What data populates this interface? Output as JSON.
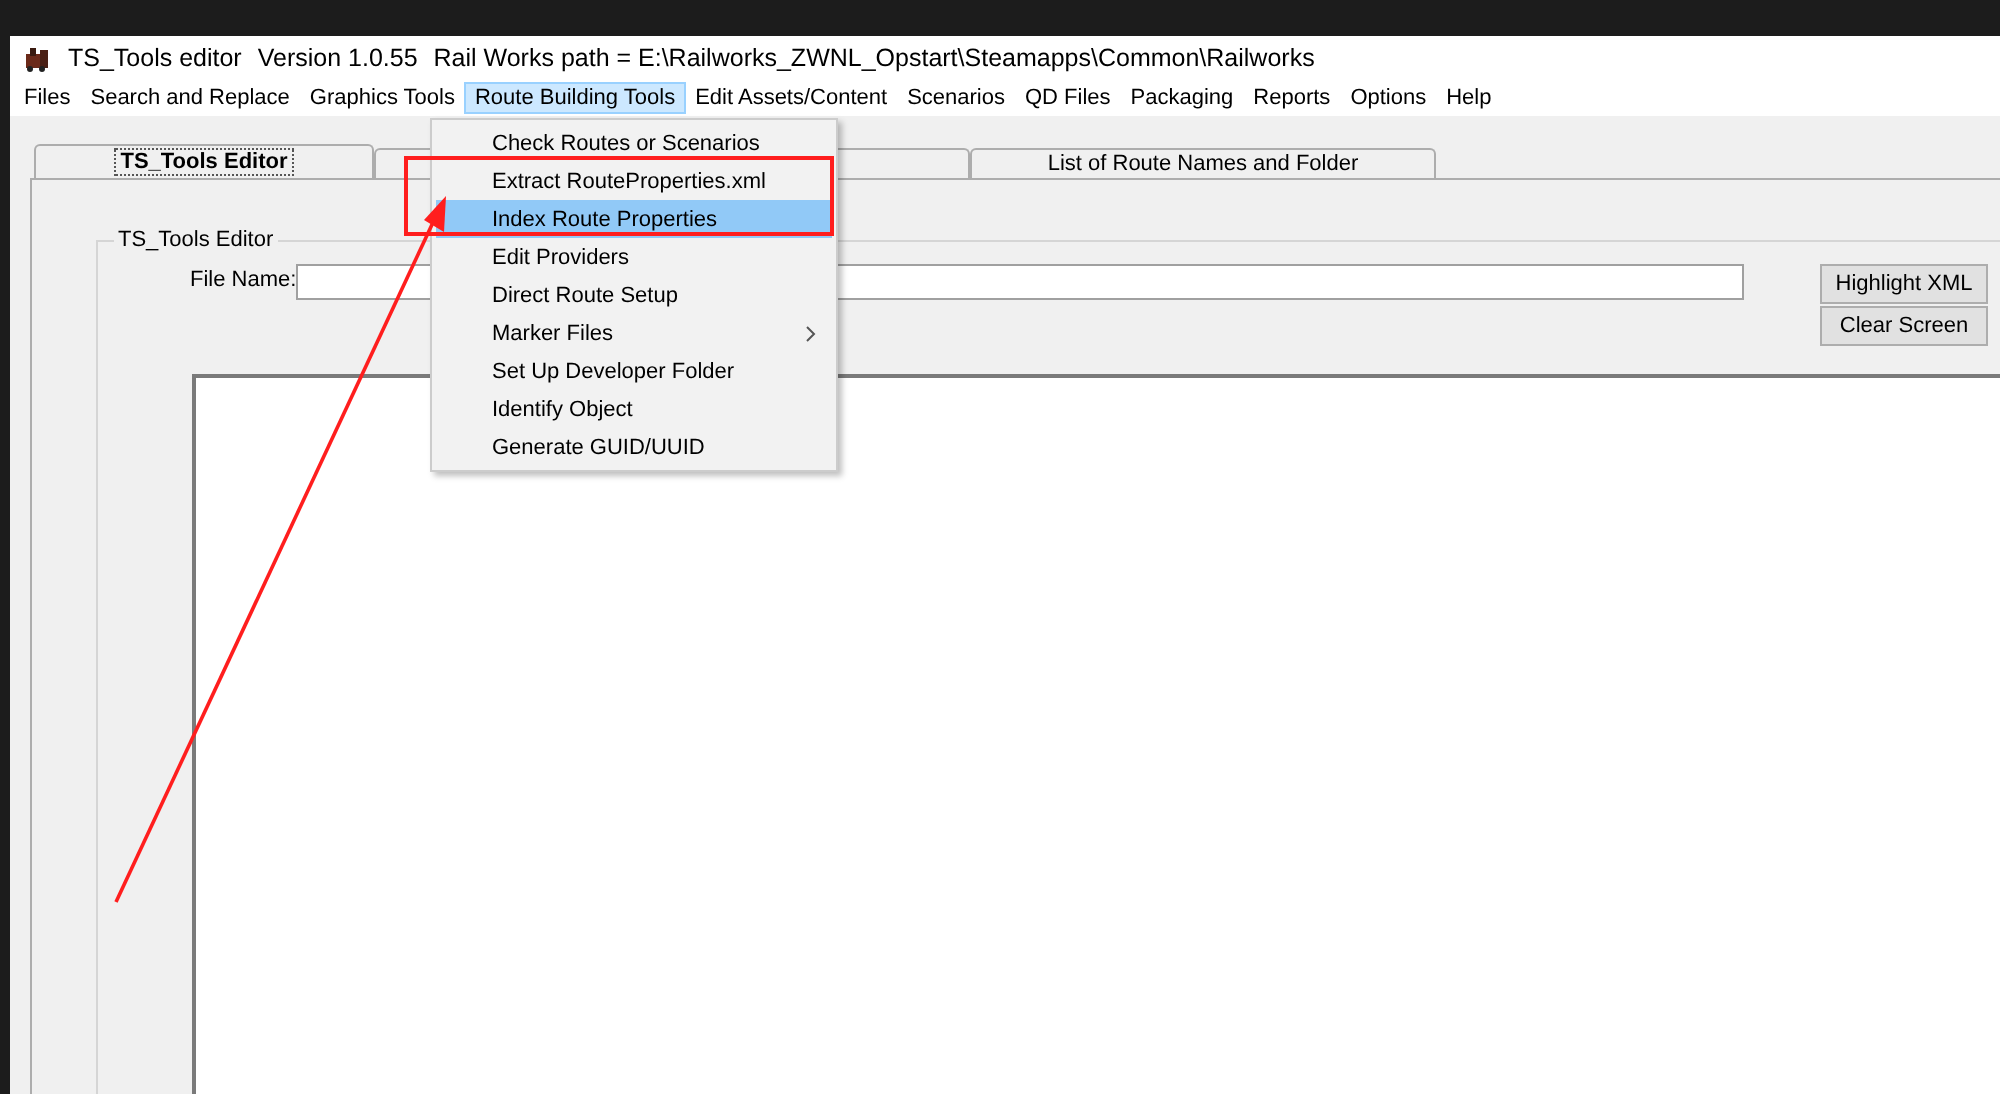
{
  "window": {
    "title": "TS_Tools editor",
    "version": "Version 1.0.55",
    "path": "Rail Works path = E:\\Railworks_ZWNL_Opstart\\Steamapps\\Common\\Railworks"
  },
  "menu_bar": [
    {
      "label": "Files",
      "selected": false
    },
    {
      "label": "Search and Replace",
      "selected": false
    },
    {
      "label": "Graphics Tools",
      "selected": false
    },
    {
      "label": "Route Building Tools",
      "selected": true
    },
    {
      "label": "Edit Assets/Content",
      "selected": false
    },
    {
      "label": "Scenarios",
      "selected": false
    },
    {
      "label": "QD Files",
      "selected": false
    },
    {
      "label": "Packaging",
      "selected": false
    },
    {
      "label": "Reports",
      "selected": false
    },
    {
      "label": "Options",
      "selected": false
    },
    {
      "label": "Help",
      "selected": false
    }
  ],
  "dropdown_menu": [
    {
      "label": "Check Routes or Scenarios",
      "selected": false,
      "submenu": false
    },
    {
      "label": "Extract RouteProperties.xml",
      "selected": false,
      "submenu": false
    },
    {
      "label": "Index Route Properties",
      "selected": true,
      "submenu": false
    },
    {
      "label": "Edit Providers",
      "selected": false,
      "submenu": false
    },
    {
      "label": "Direct Route Setup",
      "selected": false,
      "submenu": false
    },
    {
      "label": "Marker Files",
      "selected": false,
      "submenu": true
    },
    {
      "label": "Set Up Developer Folder",
      "selected": false,
      "submenu": false
    },
    {
      "label": "Identify Object",
      "selected": false,
      "submenu": false
    },
    {
      "label": "Generate GUID/UUID",
      "selected": false,
      "submenu": false
    }
  ],
  "tabs": [
    {
      "label": "TS_Tools Editor",
      "selected": true
    },
    {
      "selected": false
    },
    {
      "label": "List of Route Names and Folder",
      "selected": false
    }
  ],
  "group": {
    "title": "TS_Tools Editor",
    "file_label": "File Name:",
    "buttons": [
      "Highlight XML",
      "Clear Screen"
    ]
  }
}
